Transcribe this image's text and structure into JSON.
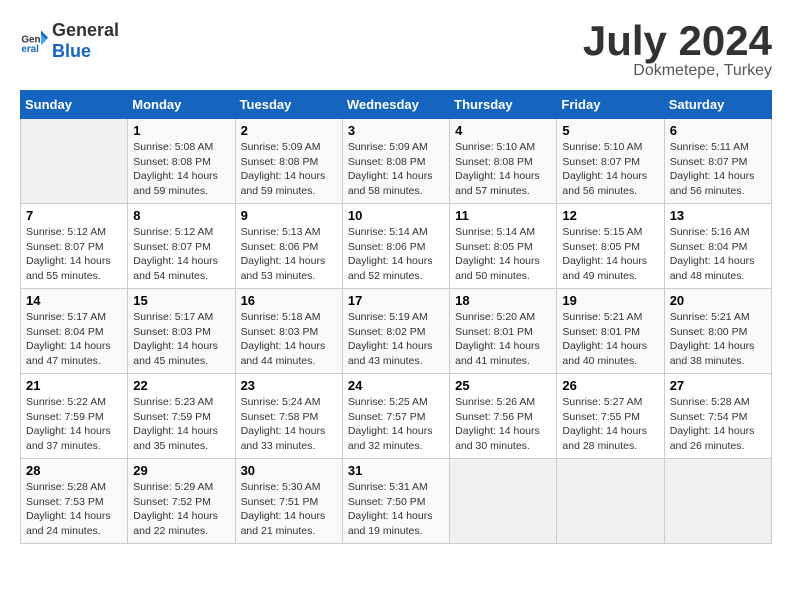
{
  "header": {
    "logo_line1": "General",
    "logo_line2": "Blue",
    "month": "July 2024",
    "location": "Dokmetepe, Turkey"
  },
  "weekdays": [
    "Sunday",
    "Monday",
    "Tuesday",
    "Wednesday",
    "Thursday",
    "Friday",
    "Saturday"
  ],
  "weeks": [
    [
      {
        "day": "",
        "info": ""
      },
      {
        "day": "1",
        "info": "Sunrise: 5:08 AM\nSunset: 8:08 PM\nDaylight: 14 hours\nand 59 minutes."
      },
      {
        "day": "2",
        "info": "Sunrise: 5:09 AM\nSunset: 8:08 PM\nDaylight: 14 hours\nand 59 minutes."
      },
      {
        "day": "3",
        "info": "Sunrise: 5:09 AM\nSunset: 8:08 PM\nDaylight: 14 hours\nand 58 minutes."
      },
      {
        "day": "4",
        "info": "Sunrise: 5:10 AM\nSunset: 8:08 PM\nDaylight: 14 hours\nand 57 minutes."
      },
      {
        "day": "5",
        "info": "Sunrise: 5:10 AM\nSunset: 8:07 PM\nDaylight: 14 hours\nand 56 minutes."
      },
      {
        "day": "6",
        "info": "Sunrise: 5:11 AM\nSunset: 8:07 PM\nDaylight: 14 hours\nand 56 minutes."
      }
    ],
    [
      {
        "day": "7",
        "info": "Sunrise: 5:12 AM\nSunset: 8:07 PM\nDaylight: 14 hours\nand 55 minutes."
      },
      {
        "day": "8",
        "info": "Sunrise: 5:12 AM\nSunset: 8:07 PM\nDaylight: 14 hours\nand 54 minutes."
      },
      {
        "day": "9",
        "info": "Sunrise: 5:13 AM\nSunset: 8:06 PM\nDaylight: 14 hours\nand 53 minutes."
      },
      {
        "day": "10",
        "info": "Sunrise: 5:14 AM\nSunset: 8:06 PM\nDaylight: 14 hours\nand 52 minutes."
      },
      {
        "day": "11",
        "info": "Sunrise: 5:14 AM\nSunset: 8:05 PM\nDaylight: 14 hours\nand 50 minutes."
      },
      {
        "day": "12",
        "info": "Sunrise: 5:15 AM\nSunset: 8:05 PM\nDaylight: 14 hours\nand 49 minutes."
      },
      {
        "day": "13",
        "info": "Sunrise: 5:16 AM\nSunset: 8:04 PM\nDaylight: 14 hours\nand 48 minutes."
      }
    ],
    [
      {
        "day": "14",
        "info": "Sunrise: 5:17 AM\nSunset: 8:04 PM\nDaylight: 14 hours\nand 47 minutes."
      },
      {
        "day": "15",
        "info": "Sunrise: 5:17 AM\nSunset: 8:03 PM\nDaylight: 14 hours\nand 45 minutes."
      },
      {
        "day": "16",
        "info": "Sunrise: 5:18 AM\nSunset: 8:03 PM\nDaylight: 14 hours\nand 44 minutes."
      },
      {
        "day": "17",
        "info": "Sunrise: 5:19 AM\nSunset: 8:02 PM\nDaylight: 14 hours\nand 43 minutes."
      },
      {
        "day": "18",
        "info": "Sunrise: 5:20 AM\nSunset: 8:01 PM\nDaylight: 14 hours\nand 41 minutes."
      },
      {
        "day": "19",
        "info": "Sunrise: 5:21 AM\nSunset: 8:01 PM\nDaylight: 14 hours\nand 40 minutes."
      },
      {
        "day": "20",
        "info": "Sunrise: 5:21 AM\nSunset: 8:00 PM\nDaylight: 14 hours\nand 38 minutes."
      }
    ],
    [
      {
        "day": "21",
        "info": "Sunrise: 5:22 AM\nSunset: 7:59 PM\nDaylight: 14 hours\nand 37 minutes."
      },
      {
        "day": "22",
        "info": "Sunrise: 5:23 AM\nSunset: 7:59 PM\nDaylight: 14 hours\nand 35 minutes."
      },
      {
        "day": "23",
        "info": "Sunrise: 5:24 AM\nSunset: 7:58 PM\nDaylight: 14 hours\nand 33 minutes."
      },
      {
        "day": "24",
        "info": "Sunrise: 5:25 AM\nSunset: 7:57 PM\nDaylight: 14 hours\nand 32 minutes."
      },
      {
        "day": "25",
        "info": "Sunrise: 5:26 AM\nSunset: 7:56 PM\nDaylight: 14 hours\nand 30 minutes."
      },
      {
        "day": "26",
        "info": "Sunrise: 5:27 AM\nSunset: 7:55 PM\nDaylight: 14 hours\nand 28 minutes."
      },
      {
        "day": "27",
        "info": "Sunrise: 5:28 AM\nSunset: 7:54 PM\nDaylight: 14 hours\nand 26 minutes."
      }
    ],
    [
      {
        "day": "28",
        "info": "Sunrise: 5:28 AM\nSunset: 7:53 PM\nDaylight: 14 hours\nand 24 minutes."
      },
      {
        "day": "29",
        "info": "Sunrise: 5:29 AM\nSunset: 7:52 PM\nDaylight: 14 hours\nand 22 minutes."
      },
      {
        "day": "30",
        "info": "Sunrise: 5:30 AM\nSunset: 7:51 PM\nDaylight: 14 hours\nand 21 minutes."
      },
      {
        "day": "31",
        "info": "Sunrise: 5:31 AM\nSunset: 7:50 PM\nDaylight: 14 hours\nand 19 minutes."
      },
      {
        "day": "",
        "info": ""
      },
      {
        "day": "",
        "info": ""
      },
      {
        "day": "",
        "info": ""
      }
    ]
  ]
}
